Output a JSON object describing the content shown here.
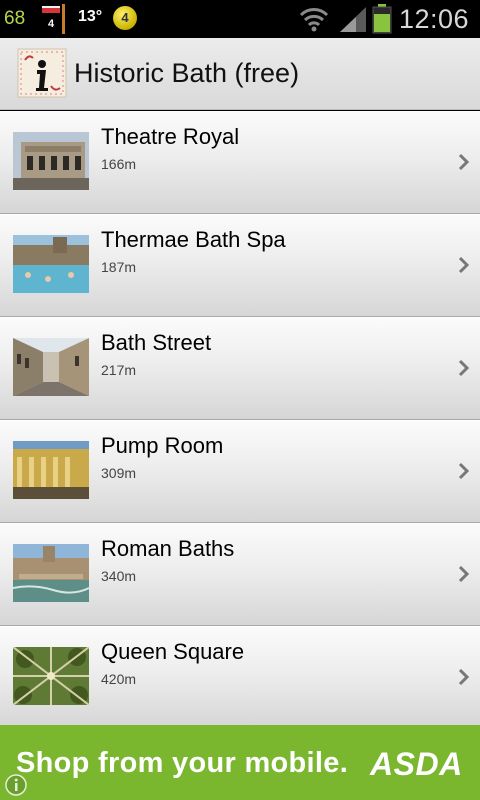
{
  "status_bar": {
    "battery_level_text": "68",
    "notif_count": "4",
    "temperature": "13°",
    "badge_count": "4",
    "time": "12:06"
  },
  "app": {
    "title": "Historic Bath (free)",
    "logo_icon": "bath-info-icon"
  },
  "places": [
    {
      "name": "Theatre Royal",
      "distance": "166m",
      "thumb": "theatre-royal-photo"
    },
    {
      "name": "Thermae Bath Spa",
      "distance": "187m",
      "thumb": "thermae-bath-spa-photo"
    },
    {
      "name": "Bath Street",
      "distance": "217m",
      "thumb": "bath-street-photo"
    },
    {
      "name": "Pump Room",
      "distance": "309m",
      "thumb": "pump-room-photo"
    },
    {
      "name": "Roman Baths",
      "distance": "340m",
      "thumb": "roman-baths-photo"
    },
    {
      "name": "Queen Square",
      "distance": "420m",
      "thumb": "queen-square-photo"
    }
  ],
  "ad": {
    "text": "Shop from your mobile.",
    "brand": "ASDA",
    "color": "#7ab62e"
  }
}
